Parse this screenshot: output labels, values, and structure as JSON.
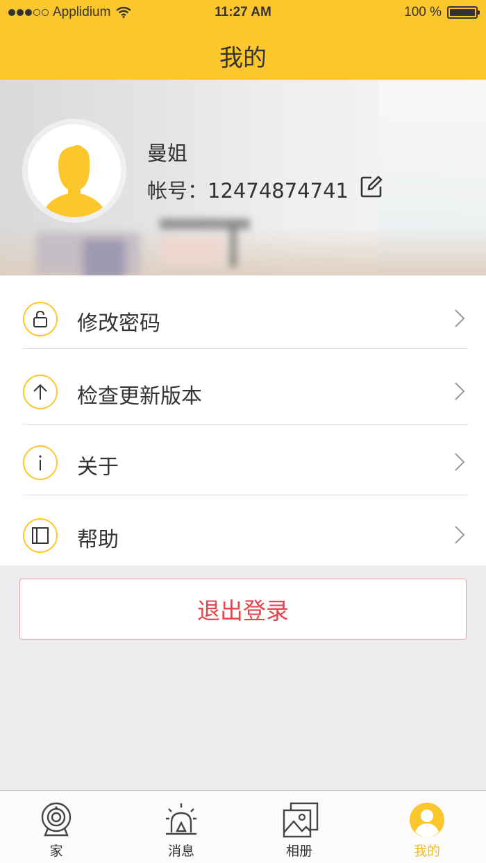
{
  "status_bar": {
    "carrier": "Applidium",
    "time": "11:27 AM",
    "battery": "100 %"
  },
  "nav": {
    "title": "我的"
  },
  "profile": {
    "name": "曼姐",
    "account_label": "帐号：",
    "account_number": "12474874741"
  },
  "menu": {
    "items": [
      {
        "label": "修改密码",
        "icon": "lock-icon"
      },
      {
        "label": "检查更新版本",
        "icon": "arrow-up-icon"
      },
      {
        "label": "关于",
        "icon": "info-icon"
      },
      {
        "label": "帮助",
        "icon": "book-icon"
      }
    ]
  },
  "logout": {
    "label": "退出登录"
  },
  "tabbar": {
    "items": [
      {
        "label": "家",
        "icon": "camera-icon",
        "active": false
      },
      {
        "label": "消息",
        "icon": "alarm-icon",
        "active": false
      },
      {
        "label": "相册",
        "icon": "album-icon",
        "active": false
      },
      {
        "label": "我的",
        "icon": "user-icon",
        "active": true
      }
    ]
  },
  "colors": {
    "accent": "#fcc62d",
    "active_tab": "#f5bd18",
    "logout_text": "#e5454d",
    "logout_border": "#e8a0a4"
  }
}
